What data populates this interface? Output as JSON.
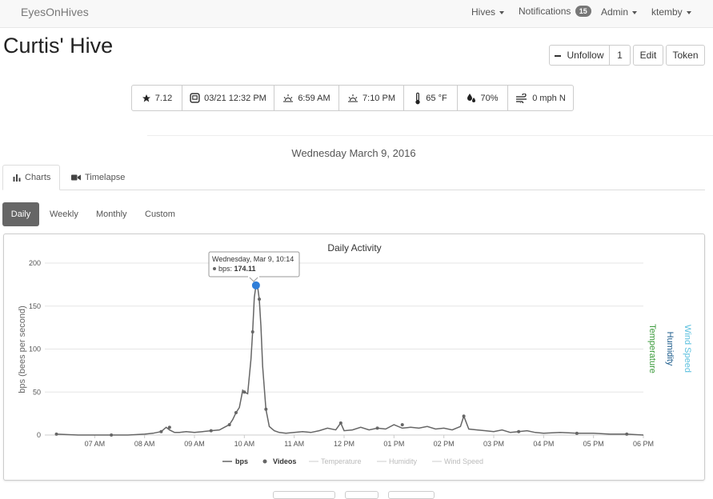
{
  "navbar": {
    "brand": "EyesOnHives",
    "hives": "Hives",
    "notifications": "Notifications",
    "notifications_count": "15",
    "admin": "Admin",
    "user": "ktemby"
  },
  "header": {
    "title": "Curtis' Hive",
    "unfollow_label": "Unfollow",
    "follow_count": "1",
    "edit_label": "Edit",
    "token_label": "Token"
  },
  "stats": {
    "rating": "7.12",
    "last_update": "03/21 12:32 PM",
    "sunrise": "6:59 AM",
    "sunset": "7:10 PM",
    "temperature": "65 °F",
    "humidity": "70%",
    "wind": "0 mph N"
  },
  "date_heading": "Wednesday March 9, 2016",
  "tabs": {
    "charts": "Charts",
    "timelapse": "Timelapse"
  },
  "ranges": {
    "daily": "Daily",
    "weekly": "Weekly",
    "monthly": "Monthly",
    "custom": "Custom"
  },
  "colors": {
    "bps": "#666666",
    "tooltip_point": "#2f7ed8",
    "temperature": "#3a9a3a",
    "humidity": "#1a5a8a",
    "wind_speed": "#5bc0de"
  },
  "chart_data": {
    "type": "line",
    "title": "Daily Activity",
    "ylabel": "bps (bees per second)",
    "ylim": [
      0,
      200
    ],
    "yticks": [
      "0",
      "50",
      "100",
      "150",
      "200"
    ],
    "xlim": [
      "06:00",
      "18:00"
    ],
    "xticks": [
      "07 AM",
      "08 AM",
      "09 AM",
      "10 AM",
      "11 AM",
      "12 PM",
      "01 PM",
      "02 PM",
      "03 PM",
      "04 PM",
      "05 PM",
      "06 PM"
    ],
    "right_axis_labels": [
      "Temperature",
      "Humidity",
      "Wind Speed"
    ],
    "legend": [
      "bps",
      "Videos",
      "Temperature",
      "Humidity",
      "Wind Speed"
    ],
    "legend_position": "bottom",
    "grid": true,
    "tooltip": {
      "header": "Wednesday, Mar 9, 10:14",
      "series": "bps",
      "value": "174.11"
    },
    "series": [
      {
        "name": "bps",
        "x": [
          "06:14",
          "06:40",
          "07:00",
          "07:20",
          "07:40",
          "08:00",
          "08:10",
          "08:20",
          "08:26",
          "08:30",
          "08:36",
          "08:42",
          "08:50",
          "09:00",
          "09:10",
          "09:20",
          "09:30",
          "09:36",
          "09:42",
          "09:46",
          "09:50",
          "09:54",
          "09:58",
          "10:00",
          "10:04",
          "10:08",
          "10:10",
          "10:12",
          "10:14",
          "10:16",
          "10:18",
          "10:20",
          "10:22",
          "10:26",
          "10:30",
          "10:36",
          "10:42",
          "10:50",
          "11:00",
          "11:10",
          "11:20",
          "11:30",
          "11:40",
          "11:50",
          "11:56",
          "12:00",
          "12:10",
          "12:20",
          "12:30",
          "12:40",
          "12:50",
          "13:00",
          "13:10",
          "13:20",
          "13:30",
          "13:40",
          "13:50",
          "14:00",
          "14:10",
          "14:20",
          "14:24",
          "14:30",
          "14:40",
          "14:50",
          "15:00",
          "15:10",
          "15:20",
          "15:30",
          "15:40",
          "15:50",
          "16:00",
          "16:20",
          "16:40",
          "17:00",
          "17:20",
          "17:40",
          "18:00"
        ],
        "y": [
          1,
          0,
          0,
          0,
          0,
          1,
          2,
          4,
          9,
          6,
          3,
          3,
          4,
          3,
          4,
          5,
          6,
          9,
          12,
          18,
          26,
          32,
          52,
          50,
          48,
          88,
          120,
          160,
          174.11,
          172,
          158,
          126,
          80,
          30,
          10,
          5,
          3,
          2,
          3,
          4,
          3,
          5,
          8,
          6,
          14,
          5,
          6,
          9,
          6,
          8,
          7,
          12,
          8,
          9,
          8,
          10,
          7,
          8,
          6,
          10,
          22,
          7,
          6,
          5,
          4,
          6,
          3,
          4,
          5,
          3,
          2,
          3,
          2,
          2,
          1,
          1,
          0
        ]
      },
      {
        "name": "Videos",
        "x": [
          "06:14",
          "07:20",
          "08:20",
          "08:30",
          "09:20",
          "09:42",
          "09:50",
          "10:00",
          "10:10",
          "10:14",
          "10:18",
          "10:26",
          "11:56",
          "12:40",
          "13:10",
          "14:24",
          "15:30",
          "16:40",
          "17:40"
        ],
        "y": [
          1,
          0,
          4,
          9,
          5,
          12,
          26,
          50,
          120,
          174.11,
          158,
          30,
          14,
          8,
          12,
          22,
          4,
          2,
          1
        ]
      }
    ]
  }
}
